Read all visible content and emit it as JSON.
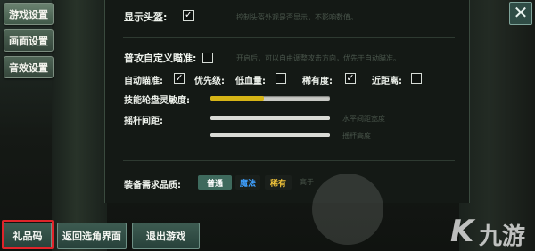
{
  "tabs": [
    {
      "label": "游戏设置",
      "active": true
    },
    {
      "label": "画面设置",
      "active": false
    },
    {
      "label": "音效设置",
      "active": false
    }
  ],
  "close": {
    "glyph": "✕"
  },
  "settings": {
    "show_head": {
      "label": "显示头盔:",
      "checked": true,
      "hint": "控制头盔外观是否显示，不影响数值。"
    },
    "custom_aim": {
      "label": "普攻自定义瞄准:",
      "checked": false,
      "hint": "开启后，可以自由调整攻击方向，优先于自动瞄准。"
    },
    "auto_aim": {
      "label": "自动瞄准:",
      "checked": true
    },
    "priority": {
      "label": "优先级:",
      "options": [
        {
          "label": "低血量:",
          "checked": false
        },
        {
          "label": "稀有度:",
          "checked": true
        },
        {
          "label": "近距离:",
          "checked": false
        }
      ]
    },
    "wheel_sensitivity": {
      "label": "技能轮盘灵敏度:",
      "level": 0.45
    },
    "joystick_spacing": {
      "label": "摇杆间距:",
      "rows": [
        {
          "hint": "水平间距宽度",
          "level": 1.0
        },
        {
          "hint": "摇杆高度",
          "level": 1.0
        }
      ]
    },
    "equip_quality": {
      "label": "装备需求品质:",
      "options": [
        {
          "label": "普通",
          "color": "#ffffff",
          "bg": "#3e6a5d"
        },
        {
          "label": "魔法",
          "color": "#3ea0ff",
          "bg": "#1a1f1b"
        },
        {
          "label": "稀有",
          "color": "#f2c43a",
          "bg": "#1a1f1b"
        }
      ],
      "hint": "高于"
    }
  },
  "bottom": {
    "giftcode": "礼品码",
    "return": "返回选角界面",
    "quit": "退出游戏"
  },
  "watermark": {
    "k": "K",
    "text": "九游"
  }
}
